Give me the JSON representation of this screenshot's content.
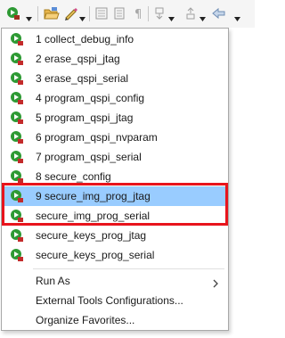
{
  "colors": {
    "run_green": "#2e9a34",
    "debug_red": "#c32b2b",
    "selection": "#99ccff",
    "highlight_border": "#e8141c"
  },
  "toolbar": {
    "icons": [
      "run-icon",
      "dropdown-arrow-icon",
      "open-folder-icon",
      "pen-icon",
      "dropdown-arrow-icon",
      "toggle-mark-icon",
      "list-icon",
      "paragraph-icon",
      "next-annotation-icon",
      "previous-annotation-icon",
      "back-icon"
    ]
  },
  "menu": {
    "favorites": [
      {
        "label": "1 collect_debug_info"
      },
      {
        "label": "2 erase_qspi_jtag"
      },
      {
        "label": "3 erase_qspi_serial"
      },
      {
        "label": "4 program_qspi_config"
      },
      {
        "label": "5 program_qspi_jtag"
      },
      {
        "label": "6 program_qspi_nvparam"
      },
      {
        "label": "7 program_qspi_serial"
      },
      {
        "label": "8 secure_config"
      },
      {
        "label": "9 secure_img_prog_jtag"
      },
      {
        "label": "secure_img_prog_serial"
      },
      {
        "label": "secure_keys_prog_jtag"
      },
      {
        "label": "secure_keys_prog_serial"
      }
    ],
    "run_as": "Run As",
    "external_tools": "External Tools Configurations...",
    "organize_favorites": "Organize Favorites..."
  }
}
